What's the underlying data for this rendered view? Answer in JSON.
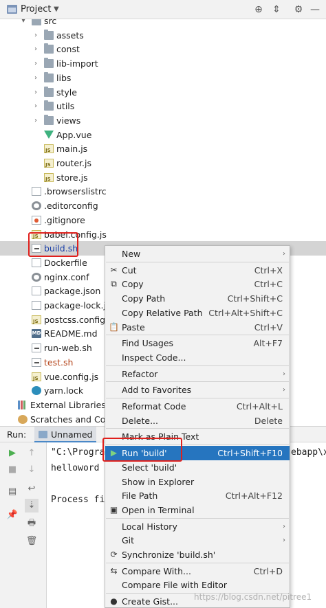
{
  "project_panel": {
    "title": "Project"
  },
  "tree": [
    {
      "label": "src",
      "type": "folder",
      "expanded": true,
      "indent": 1
    },
    {
      "label": "assets",
      "type": "folder",
      "indent": 2
    },
    {
      "label": "const",
      "type": "folder",
      "indent": 2
    },
    {
      "label": "lib-import",
      "type": "folder",
      "indent": 2
    },
    {
      "label": "libs",
      "type": "folder",
      "indent": 2
    },
    {
      "label": "style",
      "type": "folder",
      "indent": 2
    },
    {
      "label": "utils",
      "type": "folder",
      "indent": 2
    },
    {
      "label": "views",
      "type": "folder",
      "indent": 2
    },
    {
      "label": "App.vue",
      "type": "vue",
      "indent": 2
    },
    {
      "label": "main.js",
      "type": "js",
      "indent": 2
    },
    {
      "label": "router.js",
      "type": "js",
      "indent": 2
    },
    {
      "label": "store.js",
      "type": "js",
      "indent": 2
    },
    {
      "label": ".browserslistrc",
      "type": "file",
      "indent": 1
    },
    {
      "label": ".editorconfig",
      "type": "gear",
      "indent": 1
    },
    {
      "label": ".gitignore",
      "type": "git",
      "indent": 1
    },
    {
      "label": "babel.config.js",
      "type": "js",
      "indent": 1
    },
    {
      "label": "build.sh",
      "type": "sh",
      "indent": 1,
      "selected": true,
      "color": "#1a3fa8"
    },
    {
      "label": "Dockerfile",
      "type": "file",
      "indent": 1
    },
    {
      "label": "nginx.conf",
      "type": "gear",
      "indent": 1
    },
    {
      "label": "package.json",
      "type": "file",
      "indent": 1
    },
    {
      "label": "package-lock.js",
      "type": "file",
      "indent": 1
    },
    {
      "label": "postcss.config.js",
      "type": "js",
      "indent": 1
    },
    {
      "label": "README.md",
      "type": "md",
      "indent": 1
    },
    {
      "label": "run-web.sh",
      "type": "sh",
      "indent": 1
    },
    {
      "label": "test.sh",
      "type": "sh",
      "indent": 1,
      "color": "#b5451b"
    },
    {
      "label": "vue.config.js",
      "type": "js",
      "indent": 1
    },
    {
      "label": "yarn.lock",
      "type": "yarn",
      "indent": 1
    },
    {
      "label": "External Libraries",
      "type": "lib",
      "indent": 0
    },
    {
      "label": "Scratches and Cons",
      "type": "scratch",
      "indent": 0
    }
  ],
  "run_panel": {
    "label": "Run:",
    "tab_label": "Unnamed",
    "console": [
      "\"C:\\Progra",
      "helloword",
      "",
      "Process fi"
    ],
    "console_right": "ebapp\\x"
  },
  "context_menu": [
    {
      "label": "New",
      "shortcut": "",
      "submenu": true,
      "icon": ""
    },
    {
      "sep": true
    },
    {
      "label": "Cut",
      "shortcut": "Ctrl+X",
      "icon": "✂"
    },
    {
      "label": "Copy",
      "shortcut": "Ctrl+C",
      "icon": "⧉"
    },
    {
      "label": "Copy Path",
      "shortcut": "Ctrl+Shift+C",
      "icon": ""
    },
    {
      "label": "Copy Relative Path",
      "shortcut": "Ctrl+Alt+Shift+C",
      "icon": ""
    },
    {
      "label": "Paste",
      "shortcut": "Ctrl+V",
      "icon": "📋"
    },
    {
      "sep": true
    },
    {
      "label": "Find Usages",
      "shortcut": "Alt+F7",
      "icon": ""
    },
    {
      "label": "Inspect Code...",
      "shortcut": "",
      "icon": ""
    },
    {
      "sep": true
    },
    {
      "label": "Refactor",
      "shortcut": "",
      "submenu": true,
      "icon": ""
    },
    {
      "sep": true
    },
    {
      "label": "Add to Favorites",
      "shortcut": "",
      "submenu": true,
      "icon": ""
    },
    {
      "sep": true
    },
    {
      "label": "Reformat Code",
      "shortcut": "Ctrl+Alt+L",
      "icon": ""
    },
    {
      "label": "Delete...",
      "shortcut": "Delete",
      "icon": ""
    },
    {
      "sep": true
    },
    {
      "label": "Mark as Plain Text",
      "shortcut": "",
      "icon": ""
    },
    {
      "sep": true
    },
    {
      "label": "Run 'build'",
      "shortcut": "Ctrl+Shift+F10",
      "icon": "▶",
      "highlight": true
    },
    {
      "label": "Select 'build'",
      "shortcut": "",
      "icon": ""
    },
    {
      "label": "Show in Explorer",
      "shortcut": "",
      "icon": ""
    },
    {
      "label": "File Path",
      "shortcut": "Ctrl+Alt+F12",
      "icon": ""
    },
    {
      "label": "Open in Terminal",
      "shortcut": "",
      "icon": "▣"
    },
    {
      "sep": true
    },
    {
      "label": "Local History",
      "shortcut": "",
      "submenu": true,
      "icon": ""
    },
    {
      "label": "Git",
      "shortcut": "",
      "submenu": true,
      "icon": ""
    },
    {
      "label": "Synchronize 'build.sh'",
      "shortcut": "",
      "icon": "⟳"
    },
    {
      "sep": true
    },
    {
      "label": "Compare With...",
      "shortcut": "Ctrl+D",
      "icon": "⇆"
    },
    {
      "label": "Compare File with Editor",
      "shortcut": "",
      "icon": ""
    },
    {
      "sep": true
    },
    {
      "label": "Create Gist...",
      "shortcut": "",
      "icon": "●"
    }
  ],
  "watermark": "https://blog.csdn.net/pitree1",
  "colors": {
    "highlight": "#2675bf",
    "selected_row": "#d4d4d4",
    "annotation_box": "#e0201c",
    "run_green": "#4caf50"
  }
}
